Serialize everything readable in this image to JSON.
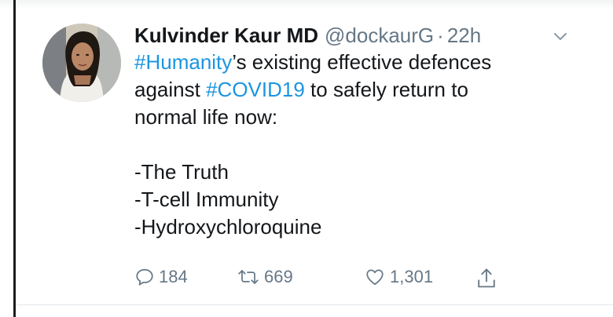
{
  "tweet": {
    "display_name": "Kulvinder Kaur MD",
    "handle": "@dockaurG",
    "separator": "·",
    "timestamp": "22h",
    "body": {
      "line1_hashtag": "#Humanity",
      "line1_rest": "’s existing effective defences",
      "line2_start": "against ",
      "line2_hashtag": "#COVID19",
      "line2_rest": " to safely return to",
      "line3": "normal life now:",
      "list": [
        "-The Truth",
        "-T-cell Immunity",
        "-Hydroxychloroquine"
      ]
    },
    "stats": {
      "replies": "184",
      "retweets": "669",
      "likes": "1,301"
    }
  },
  "colors": {
    "link": "#1b95e0",
    "secondary_text": "#657786",
    "primary_text": "#14171a"
  },
  "icons": {
    "reply": "reply-icon",
    "retweet": "retweet-icon",
    "like": "heart-icon",
    "share": "share-icon",
    "caret": "chevron-down-icon"
  }
}
